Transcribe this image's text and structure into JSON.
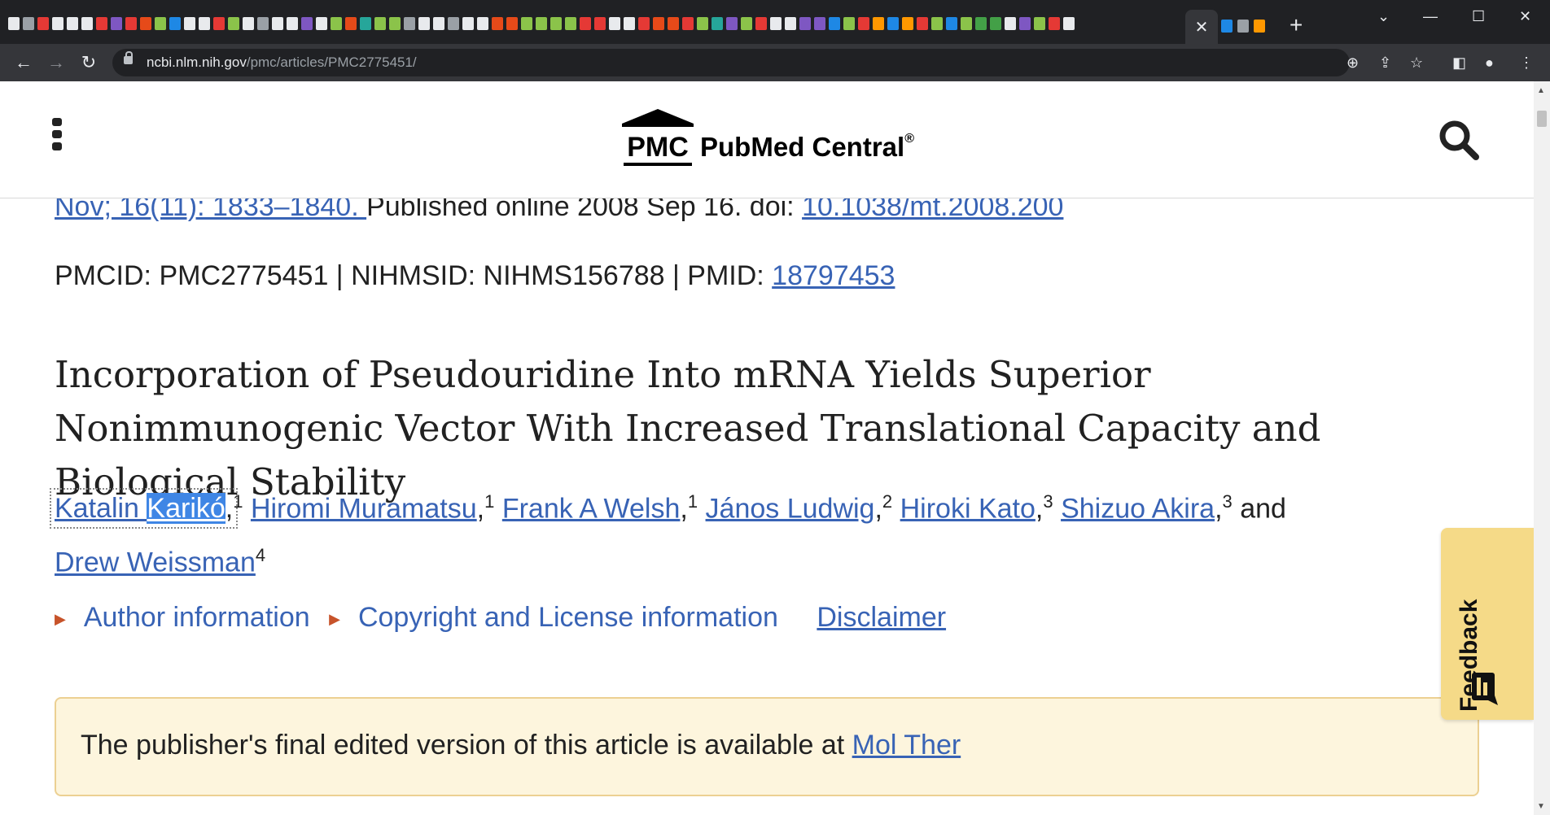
{
  "browser": {
    "active_tab_close": "✕",
    "new_tab": "+",
    "url_host": "ncbi.nlm.nih.gov",
    "url_path": "/pmc/articles/PMC2775451/",
    "win_min": "—",
    "win_max": "☐",
    "win_close": "✕",
    "tab_dropdown": "⌄",
    "favicon_colors": [
      "#e8eaed",
      "#9aa0a6",
      "#e53935",
      "#e8eaed",
      "#e8eaed",
      "#e8eaed",
      "#e53935",
      "#7e57c2",
      "#e53935",
      "#e64a19",
      "#8bc34a",
      "#1e88e5",
      "#e8eaed",
      "#e8eaed",
      "#e53935",
      "#8bc34a",
      "#e8eaed",
      "#9aa0a6",
      "#e8eaed",
      "#e8eaed",
      "#7e57c2",
      "#e8eaed",
      "#8bc34a",
      "#e64a19",
      "#26a69a",
      "#8bc34a",
      "#8bc34a",
      "#9aa0a6",
      "#e8eaed",
      "#e8eaed",
      "#9aa0a6",
      "#e8eaed",
      "#e8eaed",
      "#e64a19",
      "#e64a19",
      "#8bc34a",
      "#8bc34a",
      "#8bc34a",
      "#8bc34a",
      "#e53935",
      "#e53935",
      "#e8eaed",
      "#e8eaed",
      "#e53935",
      "#e64a19",
      "#e64a19",
      "#e53935",
      "#8bc34a",
      "#26a69a",
      "#7e57c2",
      "#8bc34a",
      "#e53935",
      "#e8eaed",
      "#e8eaed",
      "#7e57c2",
      "#7e57c2",
      "#1e88e5",
      "#8bc34a",
      "#e53935",
      "#ff9800",
      "#1e88e5",
      "#ff9800",
      "#e53935",
      "#8bc34a",
      "#1e88e5",
      "#8bc34a",
      "#43a047",
      "#43a047",
      "#e8eaed",
      "#7e57c2",
      "#8bc34a",
      "#e53935",
      "#e8eaed"
    ]
  },
  "header": {
    "logo_mark": "PMC",
    "logo_name": "PubMed Central",
    "logo_reg": "®"
  },
  "article": {
    "citation_link": "Nov; 16(11): 1833–1840. ",
    "citation_published": " Published online 2008 Sep 16. doi: ",
    "doi": "10.1038/mt.2008.200",
    "ids_text": "PMCID: PMC2775451 | NIHMSID: NIHMS156788 | PMID: ",
    "pmid": "18797453",
    "title": "Incorporation of Pseudouridine Into mRNA Yields Superior Nonimmunogenic Vector With Increased Translational Capacity and Biological Stability",
    "authors": [
      {
        "first": "Katalin ",
        "last": "Karikó",
        "sup": "1"
      },
      {
        "name": "Hiromi Muramatsu",
        "sup": "1"
      },
      {
        "name": "Frank A Welsh",
        "sup": "1"
      },
      {
        "name": "János Ludwig",
        "sup": "2"
      },
      {
        "name": "Hiroki Kato",
        "sup": "3"
      },
      {
        "name": "Shizuo Akira",
        "sup": "3"
      },
      {
        "name": "Drew Weissman",
        "sup": "4"
      }
    ],
    "and": " and",
    "author_info": "Author information",
    "copyright": "Copyright and License information",
    "disclaimer": "Disclaimer",
    "notice_text": "The publisher's final edited version of this article is available at ",
    "notice_link": "Mol Ther"
  },
  "feedback": {
    "label": "Feedback"
  }
}
